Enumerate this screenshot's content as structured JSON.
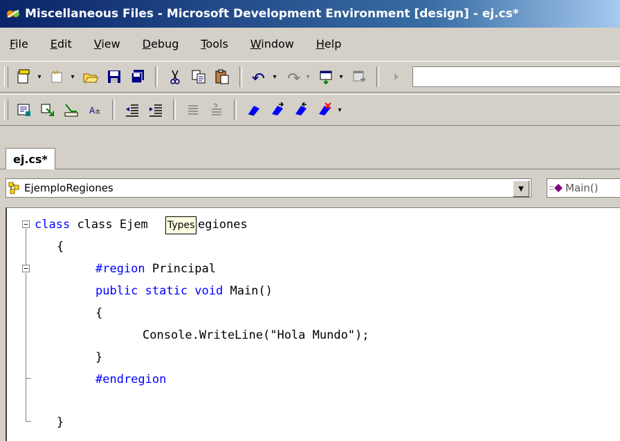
{
  "window": {
    "title": "Miscellaneous Files - Microsoft Development Environment [design] - ej.cs*",
    "app_icon": "visual-studio-icon"
  },
  "menu": {
    "items": [
      {
        "label": "File",
        "mnemonic": "F"
      },
      {
        "label": "Edit",
        "mnemonic": "E"
      },
      {
        "label": "View",
        "mnemonic": "V"
      },
      {
        "label": "Debug",
        "mnemonic": "D"
      },
      {
        "label": "Tools",
        "mnemonic": "T"
      },
      {
        "label": "Window",
        "mnemonic": "W"
      },
      {
        "label": "Help",
        "mnemonic": "H"
      }
    ]
  },
  "tabs": {
    "active": "ej.cs*"
  },
  "navigation": {
    "class_combo": "EjemploRegiones",
    "member_combo": "Main()"
  },
  "editor": {
    "tooltip": "Types",
    "lines": [
      "class Ejem",
      "egiones",
      "{",
      "#region",
      " Principal",
      "public static void",
      " Main()",
      "{",
      "Console.WriteLine(\"Hola Mundo\");",
      "}",
      "#endregion",
      "}"
    ]
  },
  "colors": {
    "keyword": "#0000ff",
    "titlebar_start": "#0a246a",
    "titlebar_end": "#a6caf0",
    "tooltip_bg": "#ffffe1"
  }
}
